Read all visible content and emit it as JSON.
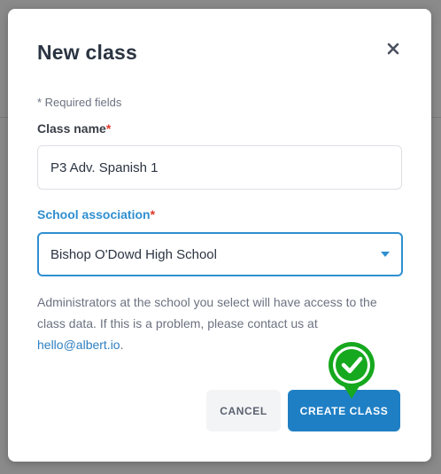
{
  "modal": {
    "title": "New class",
    "required_note": "* Required fields",
    "class_name": {
      "label": "Class name",
      "asterisk": "*",
      "value": "P3 Adv. Spanish 1"
    },
    "school_association": {
      "label": "School association",
      "asterisk": "*",
      "selected": "Bishop O'Dowd High School"
    },
    "help_text": "Administrators at the school you select will have access to the class data. If this is a problem, please contact us at",
    "help_email": "hello@albert.io",
    "help_period": ".",
    "cancel_label": "CANCEL",
    "create_label": "CREATE CLASS"
  },
  "icons": {
    "close": "close-icon",
    "dropdown": "chevron-down-icon",
    "marker": "check-circle-icon"
  },
  "colors": {
    "accent": "#2f8fd0",
    "primary_button": "#1f7fc4",
    "required": "#e0392b",
    "marker_green": "#16a81e"
  }
}
